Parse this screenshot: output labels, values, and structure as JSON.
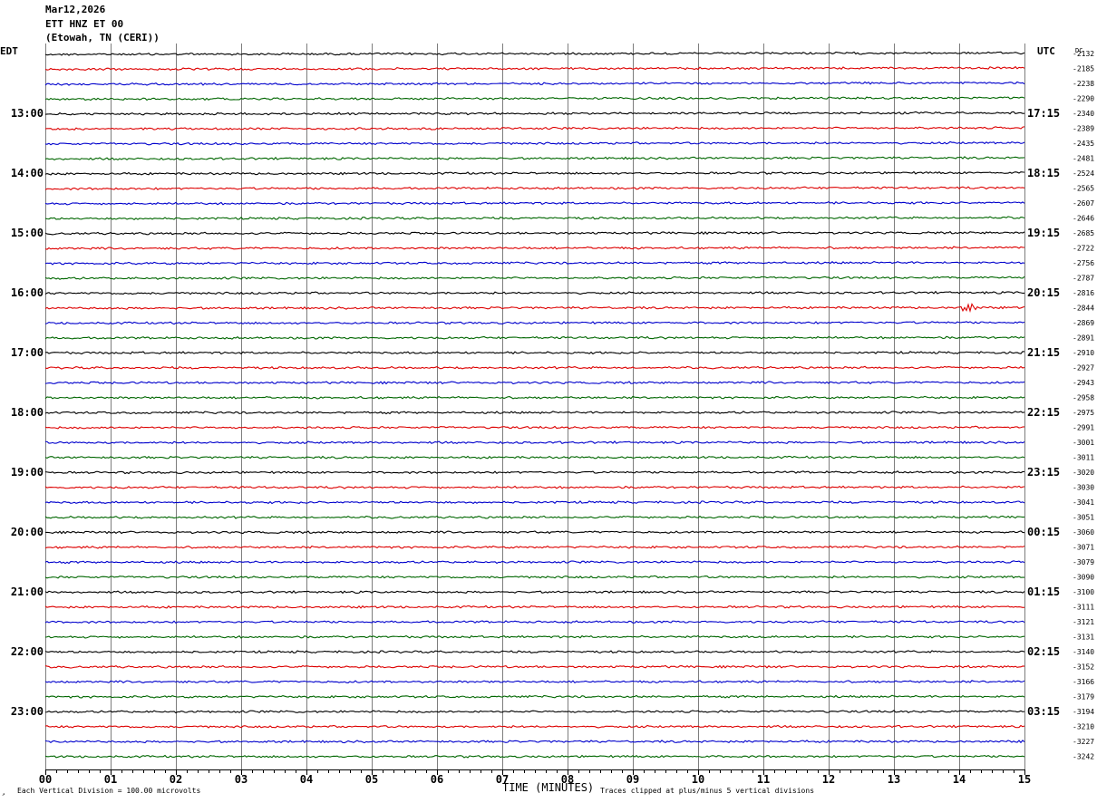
{
  "header": {
    "date": "Mar12,2026",
    "station": "ETT HNZ ET 00",
    "location": "(Etowah, TN (CERI))"
  },
  "colors": {
    "trace_cycle": [
      "#000000",
      "#dd0000",
      "#0000cc",
      "#006600"
    ],
    "grid": "#7d7d7d"
  },
  "chart_data": {
    "type": "line",
    "title": "ETT HNZ ET 00",
    "left_axis_title": "EDT",
    "right_axis_title": "UTC",
    "dc_title": "DC",
    "xlabel": "TIME (MINUTES)",
    "xlim": [
      0,
      15
    ],
    "x_ticks": [
      "00",
      "01",
      "02",
      "03",
      "04",
      "05",
      "06",
      "07",
      "08",
      "09",
      "10",
      "11",
      "12",
      "13",
      "14",
      "15"
    ],
    "rows_per_hour": 4,
    "left_hour_labels": [
      {
        "row": 4,
        "label": "13:00"
      },
      {
        "row": 8,
        "label": "14:00"
      },
      {
        "row": 12,
        "label": "15:00"
      },
      {
        "row": 16,
        "label": "16:00"
      },
      {
        "row": 20,
        "label": "17:00"
      },
      {
        "row": 24,
        "label": "18:00"
      },
      {
        "row": 28,
        "label": "19:00"
      },
      {
        "row": 32,
        "label": "20:00"
      },
      {
        "row": 36,
        "label": "21:00"
      },
      {
        "row": 40,
        "label": "22:00"
      },
      {
        "row": 44,
        "label": "23:00"
      }
    ],
    "right_hour_labels": [
      {
        "row": 4,
        "label": "17:15"
      },
      {
        "row": 8,
        "label": "18:15"
      },
      {
        "row": 12,
        "label": "19:15"
      },
      {
        "row": 16,
        "label": "20:15"
      },
      {
        "row": 20,
        "label": "21:15"
      },
      {
        "row": 24,
        "label": "22:15"
      },
      {
        "row": 28,
        "label": "23:15"
      },
      {
        "row": 32,
        "label": "00:15"
      },
      {
        "row": 36,
        "label": "01:15"
      },
      {
        "row": 40,
        "label": "02:15"
      },
      {
        "row": 44,
        "label": "03:15"
      }
    ],
    "dc_offsets": [
      "-2132",
      "-2185",
      "-2238",
      "-2290",
      "-2340",
      "-2389",
      "-2435",
      "-2481",
      "-2524",
      "-2565",
      "-2607",
      "-2646",
      "-2685",
      "-2722",
      "-2756",
      "-2787",
      "-2816",
      "-2844",
      "-2869",
      "-2891",
      "-2910",
      "-2927",
      "-2943",
      "-2958",
      "-2975",
      "-2991",
      "-3001",
      "-3011",
      "-3020",
      "-3030",
      "-3041",
      "-3051",
      "-3060",
      "-3071",
      "-3079",
      "-3090",
      "-3100",
      "-3111",
      "-3121",
      "-3131",
      "-3140",
      "-3152",
      "-3166",
      "-3179",
      "-3194",
      "-3210",
      "-3227",
      "-3242"
    ],
    "events": [
      {
        "row": 17,
        "minute": 14.15,
        "amplitude": "large"
      }
    ],
    "footer_scale": "Each Vertical Division =  100.00 microvolts",
    "footer_clip": "Traces clipped at plus/minus 5 vertical divisions",
    "grid": true
  }
}
